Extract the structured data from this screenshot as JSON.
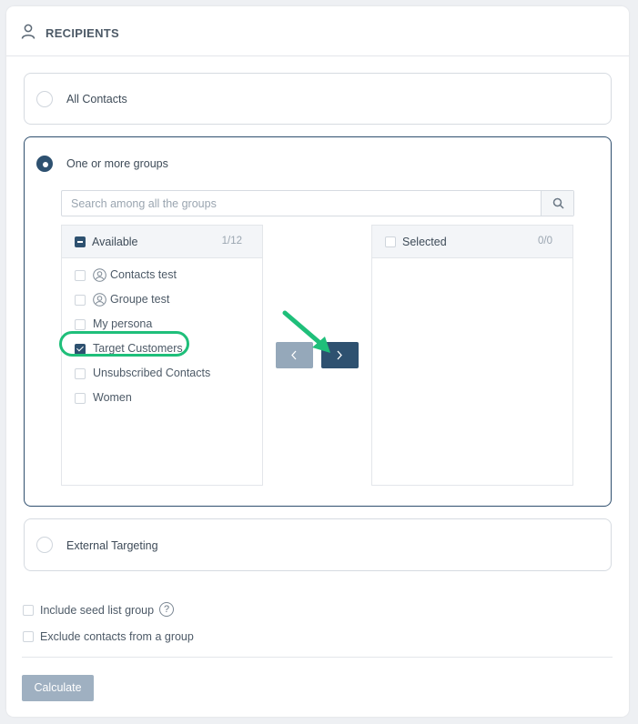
{
  "header": {
    "title": "RECIPIENTS",
    "icon": "user-icon"
  },
  "options": {
    "all_contacts": "All Contacts",
    "groups": "One or more groups",
    "external": "External Targeting"
  },
  "search": {
    "placeholder": "Search among all the groups",
    "icon": "search-icon"
  },
  "available": {
    "label": "Available",
    "count": "1/12",
    "items": [
      {
        "label": "Contacts test",
        "icon": "group-icon",
        "checked": false
      },
      {
        "label": "Groupe test",
        "icon": "group-icon",
        "checked": false
      },
      {
        "label": "My persona",
        "checked": false
      },
      {
        "label": "Target Customers",
        "checked": true
      },
      {
        "label": "Unsubscribed Contacts",
        "checked": false
      },
      {
        "label": "Women",
        "checked": false
      }
    ]
  },
  "selected": {
    "label": "Selected",
    "count": "0/0"
  },
  "bottom": {
    "seed": "Include seed list group",
    "help": "?",
    "exclude": "Exclude contacts from a group",
    "calculate": "Calculate"
  },
  "colors": {
    "primary": "#2e5170",
    "highlight": "#1fbf7a",
    "disabled": "#9fb0c1"
  }
}
